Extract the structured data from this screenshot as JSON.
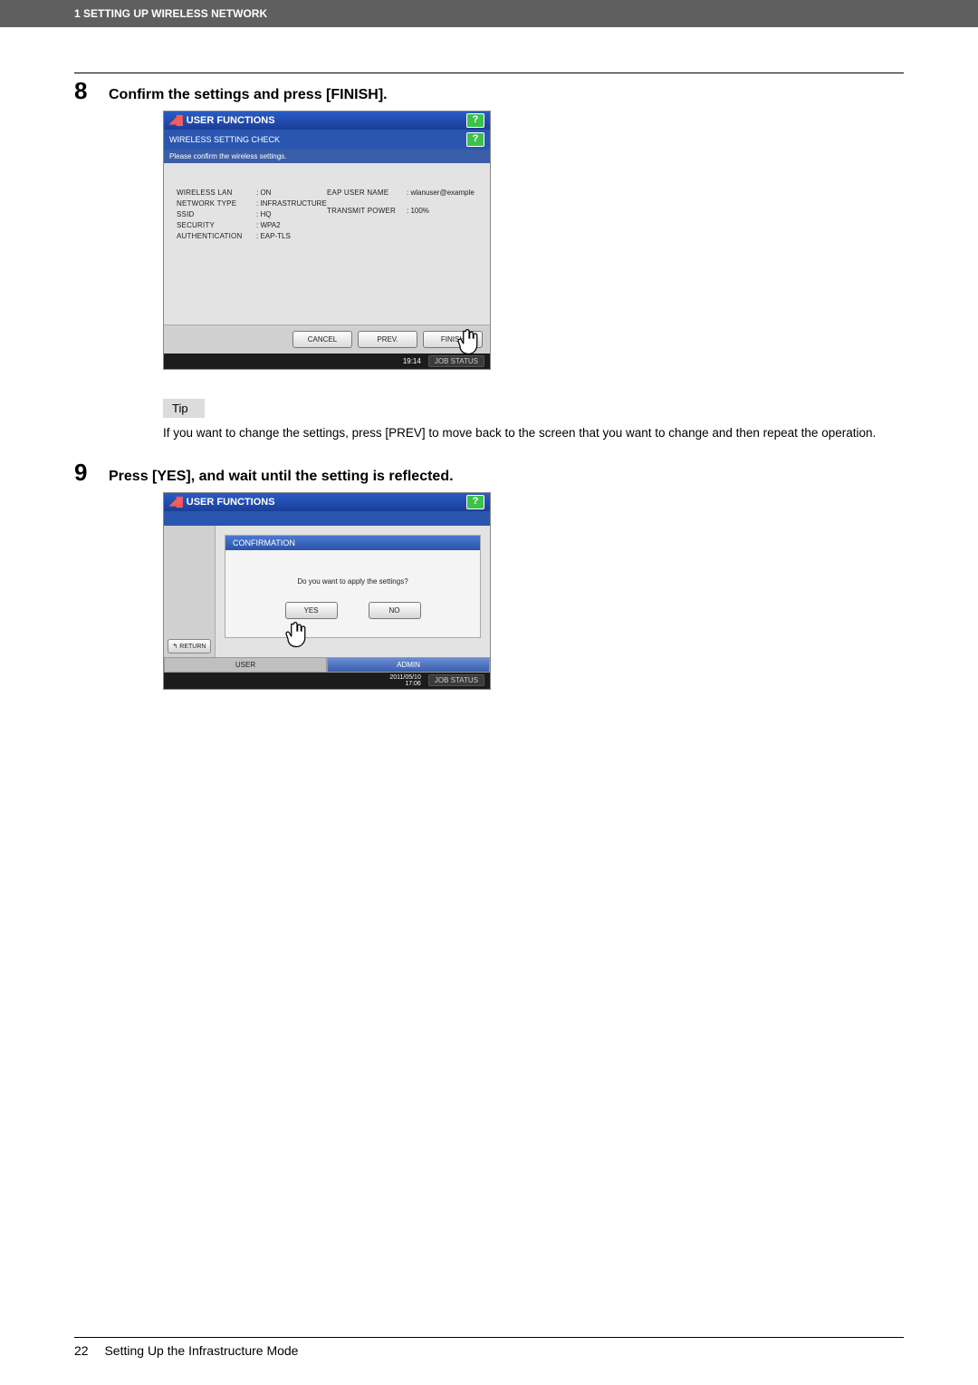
{
  "header": {
    "chapter": "1 SETTING UP WIRELESS NETWORK"
  },
  "step8": {
    "num": "8",
    "title": "Confirm the settings and press [FINISH].",
    "screen": {
      "winTitle": "USER FUNCTIONS",
      "subTitle": "WIRELESS SETTING CHECK",
      "msg": "Please confirm the wireless settings.",
      "left": [
        {
          "label": "WIRELESS LAN",
          "val": "ON"
        },
        {
          "label": "NETWORK TYPE",
          "val": "INFRASTRUCTURE"
        },
        {
          "label": "SSID",
          "val": "HQ"
        },
        {
          "label": "SECURITY",
          "val": "WPA2"
        },
        {
          "label": "AUTHENTICATION",
          "val": "EAP-TLS"
        }
      ],
      "right": [
        {
          "label": "EAP USER NAME",
          "val": "wlanuser@example"
        },
        {
          "label": "TRANSMIT POWER",
          "val": "100%"
        }
      ],
      "btnCancel": "CANCEL",
      "btnPrev": "PREV.",
      "btnFinish": "FINISH",
      "time": "19:14",
      "jobStatus": "JOB STATUS"
    },
    "tipLabel": "Tip",
    "tipText": "If you want to change the settings, press [PREV] to move back to the screen that you want to change and then repeat the operation."
  },
  "step9": {
    "num": "9",
    "title": "Press [YES], and wait until the setting is reflected.",
    "screen": {
      "winTitle": "USER FUNCTIONS",
      "confHead": "CONFIRMATION",
      "question": "Do you want to apply the settings?",
      "yes": "YES",
      "no": "NO",
      "return": "↰  RETURN",
      "tabUser": "USER",
      "tabAdmin": "ADMIN",
      "date": "2011/05/10",
      "time": "17:06",
      "jobStatus": "JOB STATUS"
    }
  },
  "footer": {
    "pageNum": "22",
    "pageTitle": "Setting Up the Infrastructure Mode"
  }
}
